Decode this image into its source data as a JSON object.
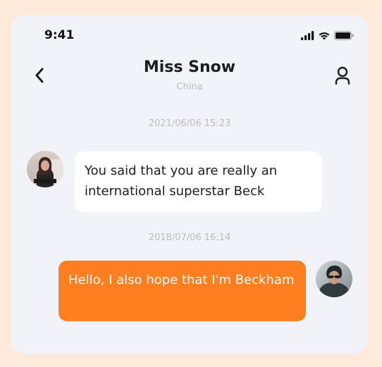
{
  "status_bar": {
    "time": "9:41",
    "signal_icon": "cellular-signal-icon",
    "wifi_icon": "wifi-icon",
    "battery_icon": "battery-icon"
  },
  "header": {
    "back_icon": "chevron-left-icon",
    "contact_name": "Miss Snow",
    "contact_location": "China",
    "profile_icon": "user-profile-icon"
  },
  "messages": [
    {
      "timestamp": "2021/06/06 15:23",
      "direction": "incoming",
      "text": "You said that you are really an international superstar Beck"
    },
    {
      "timestamp": "2018/07/06 16:14",
      "direction": "outgoing",
      "text": "Hello, I also hope that I'm Beckham"
    }
  ],
  "colors": {
    "outer_background": "#FEEADA",
    "screen_background": "#F2F3F8",
    "outgoing_bubble": "#FF7E1F",
    "incoming_bubble": "#FFFFFF",
    "muted_text": "#B8BCCB"
  }
}
